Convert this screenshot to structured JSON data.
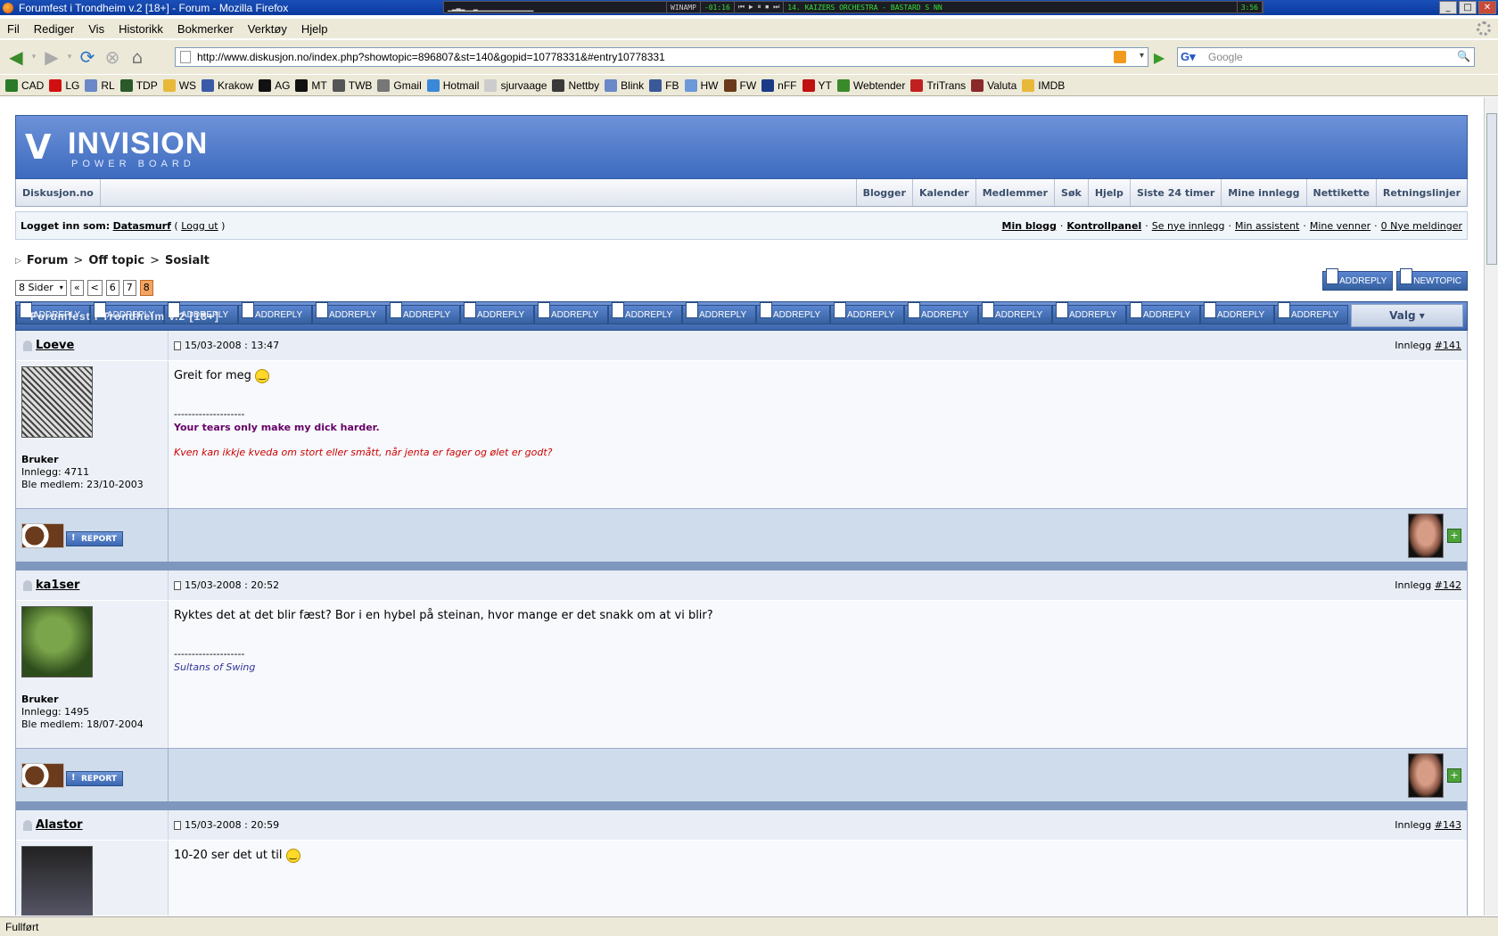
{
  "window": {
    "title": "Forumfest i Trondheim v.2 [18+] - Forum - Mozilla Firefox"
  },
  "winamp": {
    "label": "WINAMP",
    "time": "-01:16",
    "track": "14. KAIZERS ORCHESTRA - BASTARD S NN",
    "track_time": "3:56"
  },
  "menu": {
    "items": [
      "Fil",
      "Rediger",
      "Vis",
      "Historikk",
      "Bokmerker",
      "Verktøy",
      "Hjelp"
    ]
  },
  "nav": {
    "url": "http://www.diskusjon.no/index.php?showtopic=896807&st=140&gopid=10778331&#entry10778331",
    "search_placeholder": "Google"
  },
  "bookmarks": [
    {
      "label": "CAD",
      "icon": "cad-icon",
      "color": "#2a7a2a"
    },
    {
      "label": "LG",
      "icon": "heart-icon",
      "color": "#d01010"
    },
    {
      "label": "RL",
      "icon": "oval-icon",
      "color": "#6a88c8"
    },
    {
      "label": "TDP",
      "icon": "k-icon",
      "color": "#2a5a2a"
    },
    {
      "label": "WS",
      "icon": "folder-icon",
      "color": "#e8b838"
    },
    {
      "label": "Krakow",
      "icon": "crest-icon",
      "color": "#3a5aa8"
    },
    {
      "label": "AG",
      "icon": "power-icon",
      "color": "#111111"
    },
    {
      "label": "MT",
      "icon": "mt-icon",
      "color": "#111111"
    },
    {
      "label": "TWB",
      "icon": "twb-icon",
      "color": "#555555"
    },
    {
      "label": "Gmail",
      "icon": "gmail-icon",
      "color": "#777777"
    },
    {
      "label": "Hotmail",
      "icon": "msn-icon",
      "color": "#3a88d8"
    },
    {
      "label": "sjurvaage",
      "icon": "page-icon",
      "color": "#cccccc"
    },
    {
      "label": "Nettby",
      "icon": "nettby-icon",
      "color": "#3a3a3a"
    },
    {
      "label": "Blink",
      "icon": "blink-icon",
      "color": "#6a88c8"
    },
    {
      "label": "FB",
      "icon": "facebook-icon",
      "color": "#3b5998"
    },
    {
      "label": "HW",
      "icon": "hw-icon",
      "color": "#6a98d8"
    },
    {
      "label": "FW",
      "icon": "fw-icon",
      "color": "#6a3a1a"
    },
    {
      "label": "nFF",
      "icon": "nff-icon",
      "color": "#1a3a88"
    },
    {
      "label": "YT",
      "icon": "youtube-icon",
      "color": "#c01010"
    },
    {
      "label": "Webtender",
      "icon": "cocktail-icon",
      "color": "#3a8a2a"
    },
    {
      "label": "TriTrans",
      "icon": "tritrans-icon",
      "color": "#c02020"
    },
    {
      "label": "Valuta",
      "icon": "valuta-icon",
      "color": "#8a2a2a"
    },
    {
      "label": "IMDB",
      "icon": "imdb-icon",
      "color": "#e8b838"
    }
  ],
  "forum": {
    "logo_title": "INVISION",
    "logo_subtitle": "POWER BOARD",
    "home": "Diskusjon.no",
    "navlinks": [
      "Blogger",
      "Kalender",
      "Medlemmer",
      "Søk",
      "Hjelp",
      "Siste 24 timer",
      "Mine innlegg",
      "Nettikette",
      "Retningslinjer"
    ],
    "logged_in_label": "Logget inn som:",
    "username": "Datasmurf",
    "logout": "Logg ut",
    "user_links": [
      "Min blogg",
      "Kontrollpanel",
      "Se nye innlegg",
      "Min assistent",
      "Mine venner",
      "0 Nye meldinger"
    ],
    "breadcrumb": [
      "Forum",
      "Off topic",
      "Sosialt"
    ],
    "pages_label": "8 Sider",
    "page_first": "«",
    "page_prev": "<",
    "pages": [
      "6",
      "7",
      "8"
    ],
    "current_page": "8",
    "add_reply": "ADDREPLY",
    "new_topic": "NEWTOPIC",
    "topic_title": "Forumfest i Trondheim v.2 [18+]",
    "options": "Valg ▾",
    "report_label": "REPORT",
    "post_label": "Innlegg"
  },
  "posts": [
    {
      "author": "Loeve",
      "date": "15/03-2008 : 13:47",
      "number": "#141",
      "group": "Bruker",
      "posts": "Innlegg: 4711",
      "joined": "Ble medlem: 23/10-2003",
      "text": "Greit for meg",
      "sig_line": "--------------------",
      "sig1": "Your tears only make my dick harder.",
      "sig1_color": "#660066",
      "sig2": "Kven kan ikkje kveda om stort eller smått, når jenta er fager og ølet er godt?",
      "sig2_color": "#cc0000"
    },
    {
      "author": "ka1ser",
      "date": "15/03-2008 : 20:52",
      "number": "#142",
      "group": "Bruker",
      "posts": "Innlegg: 1495",
      "joined": "Ble medlem: 18/07-2004",
      "text": "Ryktes det at det blir fæst? Bor i en hybel på steinan, hvor mange er det snakk om at vi blir?",
      "sig_line": "--------------------",
      "sig1": "Sultans of Swing",
      "sig1_color": "#333399"
    },
    {
      "author": "Alastor",
      "date": "15/03-2008 : 20:59",
      "number": "#143",
      "text": "10-20 ser det ut til"
    }
  ],
  "status": {
    "text": "Fullført"
  }
}
